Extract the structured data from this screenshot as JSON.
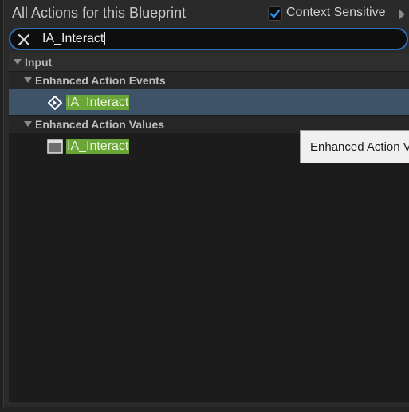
{
  "header": {
    "title": "All Actions for this Blueprint",
    "context_sensitive_label": "Context Sensitive",
    "context_sensitive_checked": true
  },
  "search": {
    "value": "IA_Interact",
    "clear_icon": "close-icon"
  },
  "tree": {
    "root": {
      "label": "Input"
    },
    "categories": [
      {
        "label": "Enhanced Action Events",
        "items": [
          {
            "label": "IA_Interact",
            "icon": "event-diamond-icon",
            "selected": true
          }
        ]
      },
      {
        "label": "Enhanced Action Values",
        "items": [
          {
            "label": "IA_Interact",
            "icon": "value-box-icon",
            "selected": false
          }
        ]
      }
    ]
  },
  "tooltip": {
    "text": "Enhanced Action V"
  },
  "colors": {
    "accent": "#2f6fb8",
    "highlight": "#6aa637",
    "selection": "#3f5368"
  }
}
